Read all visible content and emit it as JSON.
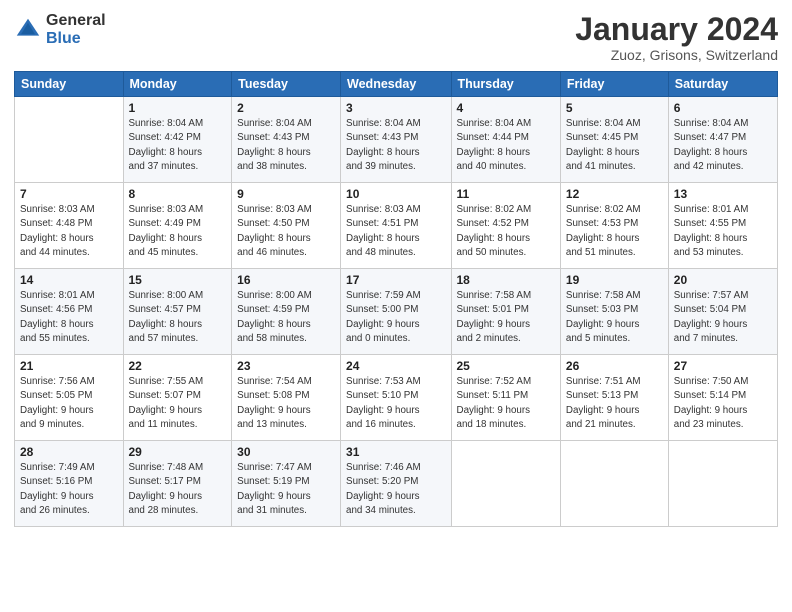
{
  "logo": {
    "line1": "General",
    "line2": "Blue"
  },
  "header": {
    "title": "January 2024",
    "subtitle": "Zuoz, Grisons, Switzerland"
  },
  "weekdays": [
    "Sunday",
    "Monday",
    "Tuesday",
    "Wednesday",
    "Thursday",
    "Friday",
    "Saturday"
  ],
  "weeks": [
    [
      {
        "day": "",
        "info": ""
      },
      {
        "day": "1",
        "info": "Sunrise: 8:04 AM\nSunset: 4:42 PM\nDaylight: 8 hours\nand 37 minutes."
      },
      {
        "day": "2",
        "info": "Sunrise: 8:04 AM\nSunset: 4:43 PM\nDaylight: 8 hours\nand 38 minutes."
      },
      {
        "day": "3",
        "info": "Sunrise: 8:04 AM\nSunset: 4:43 PM\nDaylight: 8 hours\nand 39 minutes."
      },
      {
        "day": "4",
        "info": "Sunrise: 8:04 AM\nSunset: 4:44 PM\nDaylight: 8 hours\nand 40 minutes."
      },
      {
        "day": "5",
        "info": "Sunrise: 8:04 AM\nSunset: 4:45 PM\nDaylight: 8 hours\nand 41 minutes."
      },
      {
        "day": "6",
        "info": "Sunrise: 8:04 AM\nSunset: 4:47 PM\nDaylight: 8 hours\nand 42 minutes."
      }
    ],
    [
      {
        "day": "7",
        "info": "Sunrise: 8:03 AM\nSunset: 4:48 PM\nDaylight: 8 hours\nand 44 minutes."
      },
      {
        "day": "8",
        "info": "Sunrise: 8:03 AM\nSunset: 4:49 PM\nDaylight: 8 hours\nand 45 minutes."
      },
      {
        "day": "9",
        "info": "Sunrise: 8:03 AM\nSunset: 4:50 PM\nDaylight: 8 hours\nand 46 minutes."
      },
      {
        "day": "10",
        "info": "Sunrise: 8:03 AM\nSunset: 4:51 PM\nDaylight: 8 hours\nand 48 minutes."
      },
      {
        "day": "11",
        "info": "Sunrise: 8:02 AM\nSunset: 4:52 PM\nDaylight: 8 hours\nand 50 minutes."
      },
      {
        "day": "12",
        "info": "Sunrise: 8:02 AM\nSunset: 4:53 PM\nDaylight: 8 hours\nand 51 minutes."
      },
      {
        "day": "13",
        "info": "Sunrise: 8:01 AM\nSunset: 4:55 PM\nDaylight: 8 hours\nand 53 minutes."
      }
    ],
    [
      {
        "day": "14",
        "info": "Sunrise: 8:01 AM\nSunset: 4:56 PM\nDaylight: 8 hours\nand 55 minutes."
      },
      {
        "day": "15",
        "info": "Sunrise: 8:00 AM\nSunset: 4:57 PM\nDaylight: 8 hours\nand 57 minutes."
      },
      {
        "day": "16",
        "info": "Sunrise: 8:00 AM\nSunset: 4:59 PM\nDaylight: 8 hours\nand 58 minutes."
      },
      {
        "day": "17",
        "info": "Sunrise: 7:59 AM\nSunset: 5:00 PM\nDaylight: 9 hours\nand 0 minutes."
      },
      {
        "day": "18",
        "info": "Sunrise: 7:58 AM\nSunset: 5:01 PM\nDaylight: 9 hours\nand 2 minutes."
      },
      {
        "day": "19",
        "info": "Sunrise: 7:58 AM\nSunset: 5:03 PM\nDaylight: 9 hours\nand 5 minutes."
      },
      {
        "day": "20",
        "info": "Sunrise: 7:57 AM\nSunset: 5:04 PM\nDaylight: 9 hours\nand 7 minutes."
      }
    ],
    [
      {
        "day": "21",
        "info": "Sunrise: 7:56 AM\nSunset: 5:05 PM\nDaylight: 9 hours\nand 9 minutes."
      },
      {
        "day": "22",
        "info": "Sunrise: 7:55 AM\nSunset: 5:07 PM\nDaylight: 9 hours\nand 11 minutes."
      },
      {
        "day": "23",
        "info": "Sunrise: 7:54 AM\nSunset: 5:08 PM\nDaylight: 9 hours\nand 13 minutes."
      },
      {
        "day": "24",
        "info": "Sunrise: 7:53 AM\nSunset: 5:10 PM\nDaylight: 9 hours\nand 16 minutes."
      },
      {
        "day": "25",
        "info": "Sunrise: 7:52 AM\nSunset: 5:11 PM\nDaylight: 9 hours\nand 18 minutes."
      },
      {
        "day": "26",
        "info": "Sunrise: 7:51 AM\nSunset: 5:13 PM\nDaylight: 9 hours\nand 21 minutes."
      },
      {
        "day": "27",
        "info": "Sunrise: 7:50 AM\nSunset: 5:14 PM\nDaylight: 9 hours\nand 23 minutes."
      }
    ],
    [
      {
        "day": "28",
        "info": "Sunrise: 7:49 AM\nSunset: 5:16 PM\nDaylight: 9 hours\nand 26 minutes."
      },
      {
        "day": "29",
        "info": "Sunrise: 7:48 AM\nSunset: 5:17 PM\nDaylight: 9 hours\nand 28 minutes."
      },
      {
        "day": "30",
        "info": "Sunrise: 7:47 AM\nSunset: 5:19 PM\nDaylight: 9 hours\nand 31 minutes."
      },
      {
        "day": "31",
        "info": "Sunrise: 7:46 AM\nSunset: 5:20 PM\nDaylight: 9 hours\nand 34 minutes."
      },
      {
        "day": "",
        "info": ""
      },
      {
        "day": "",
        "info": ""
      },
      {
        "day": "",
        "info": ""
      }
    ]
  ]
}
